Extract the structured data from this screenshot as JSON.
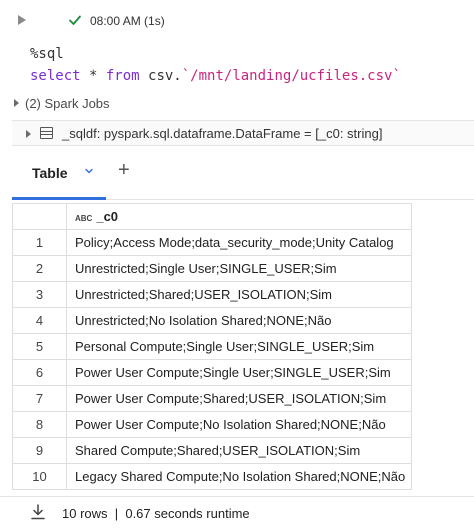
{
  "cell": {
    "status_time": "08:00 AM (1s)",
    "status_color": "#1e8a3c"
  },
  "code": {
    "magic": "%sql",
    "kw_select": "select",
    "star": " * ",
    "kw_from": "from",
    "source_prefix": " csv.",
    "path": "`/mnt/landing/ucfiles.csv`"
  },
  "spark_jobs": {
    "label": "(2) Spark Jobs"
  },
  "dataframe": {
    "label": "_sqldf:  pyspark.sql.dataframe.DataFrame = [_c0: string]"
  },
  "tabs": {
    "table_label": "Table",
    "add_label": "+"
  },
  "table": {
    "type_icon": "ABC",
    "column_header": "_c0",
    "rows": [
      {
        "index": "1",
        "value": "Policy;Access Mode;data_security_mode;Unity Catalog"
      },
      {
        "index": "2",
        "value": "Unrestricted;Single User;SINGLE_USER;Sim"
      },
      {
        "index": "3",
        "value": "Unrestricted;Shared;USER_ISOLATION;Sim"
      },
      {
        "index": "4",
        "value": "Unrestricted;No Isolation Shared;NONE;Não"
      },
      {
        "index": "5",
        "value": "Personal Compute;Single User;SINGLE_USER;Sim"
      },
      {
        "index": "6",
        "value": "Power User Compute;Single User;SINGLE_USER;Sim"
      },
      {
        "index": "7",
        "value": "Power User Compute;Shared;USER_ISOLATION;Sim"
      },
      {
        "index": "8",
        "value": "Power User Compute;No Isolation Shared;NONE;Não"
      },
      {
        "index": "9",
        "value": "Shared Compute;Shared;USER_ISOLATION;Sim"
      },
      {
        "index": "10",
        "value": "Legacy Shared Compute;No Isolation Shared;NONE;Não"
      }
    ]
  },
  "footer": {
    "summary": "10 rows  |  0.67 seconds runtime"
  },
  "colors": {
    "accent": "#2f6fde",
    "keyword": "#7a2ed1",
    "string": "#c8267e"
  }
}
